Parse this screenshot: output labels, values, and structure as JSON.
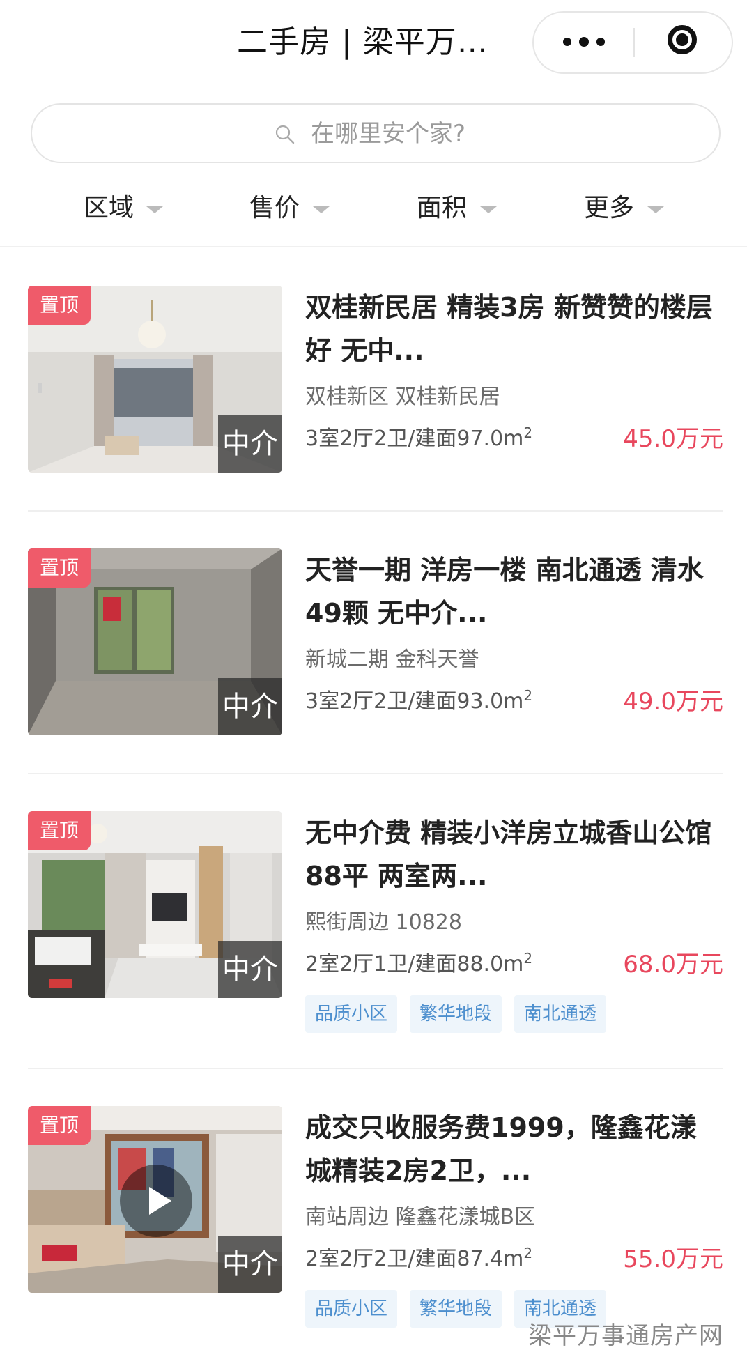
{
  "nav": {
    "title": "二手房 | 梁平万…"
  },
  "search": {
    "placeholder": "在哪里安个家?"
  },
  "filters": [
    {
      "label": "区域"
    },
    {
      "label": "售价"
    },
    {
      "label": "面积"
    },
    {
      "label": "更多"
    }
  ],
  "listings": [
    {
      "pin_label": "置顶",
      "agent_label": "中介",
      "title": "双桂新民居 精装3房 新赞赞的楼层好 无中...",
      "community": "双桂新区 双桂新民居",
      "specs": "3室2厅2卫/建面97.0m",
      "price": "45.0万元",
      "tags": []
    },
    {
      "pin_label": "置顶",
      "agent_label": "中介",
      "title": "天誉一期 洋房一楼 南北通透 清水49颗 无中介...",
      "community": "新城二期 金科天誉",
      "specs": "3室2厅2卫/建面93.0m",
      "price": "49.0万元",
      "tags": []
    },
    {
      "pin_label": "置顶",
      "agent_label": "中介",
      "title": "无中介费 精装小洋房立城香山公馆 88平 两室两...",
      "community": "熙街周边 10828",
      "specs": "2室2厅1卫/建面88.0m",
      "price": "68.0万元",
      "tags": [
        "品质小区",
        "繁华地段",
        "南北通透"
      ]
    },
    {
      "pin_label": "置顶",
      "agent_label": "中介",
      "title": "成交只收服务费1999，隆鑫花漾城精装2房2卫，...",
      "community": "南站周边 隆鑫花漾城B区",
      "specs": "2室2厅2卫/建面87.4m",
      "price": "55.0万元",
      "tags": [
        "品质小区",
        "繁华地段",
        "南北通透"
      ]
    }
  ],
  "area_unit_superscript": "2",
  "watermark": "梁平万事通房产网",
  "colors": {
    "price": "#e8475d",
    "pin_badge": "#ef5b6a",
    "tag_text": "#4d8fce",
    "tag_bg": "#eef5fb"
  }
}
